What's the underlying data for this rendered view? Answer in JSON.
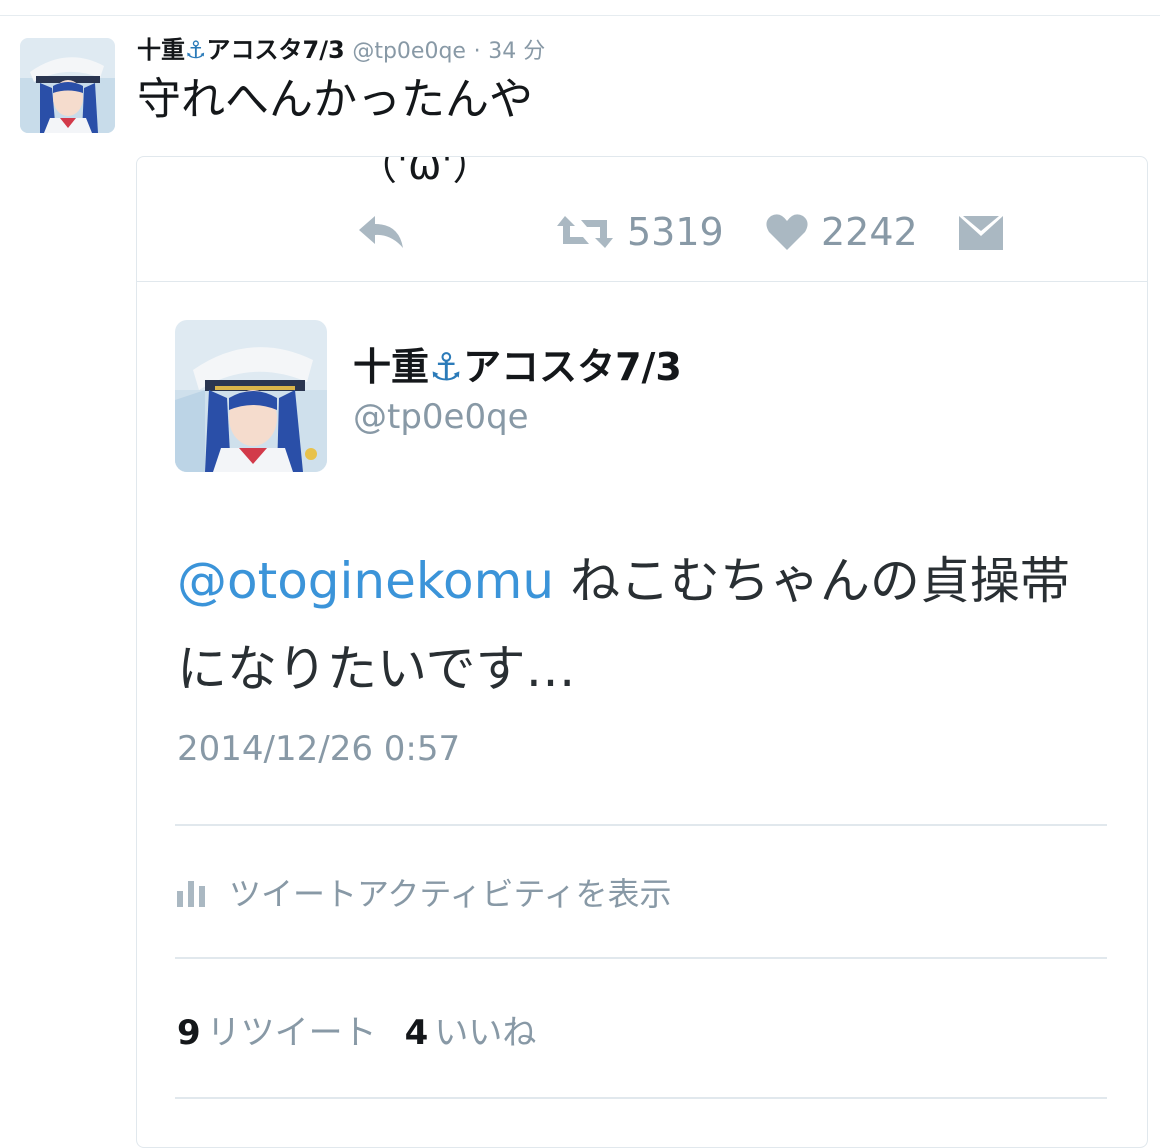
{
  "outer_tweet": {
    "display_name": "十重",
    "anchor": "⚓",
    "display_name_suffix": "アコスタ7/3",
    "handle": "@tp0e0qe",
    "separator": "·",
    "time": "34 分",
    "text": "守れへんかったんや"
  },
  "quoted_card": {
    "cut_off_text": "（'ω'）",
    "actions": {
      "retweet_count": "5319",
      "like_count": "2242"
    },
    "inner_tweet": {
      "display_name": "十重",
      "anchor": "⚓",
      "display_name_suffix": "アコスタ7/3",
      "handle": "@tp0e0qe",
      "mention": "@otoginekomu",
      "text": "ねこむちゃんの貞操帯になりたいです…",
      "date": "2014/12/26 0:57",
      "activity_label": "ツイートアクティビティを表示",
      "retweet_count": "9",
      "retweet_label": "リツイート",
      "like_count": "4",
      "like_label": "いいね"
    }
  },
  "colors": {
    "accent": "#3b94d9",
    "anchor": "#2b7bb9",
    "muted": "#8899a6",
    "icon": "#aab8c2"
  }
}
